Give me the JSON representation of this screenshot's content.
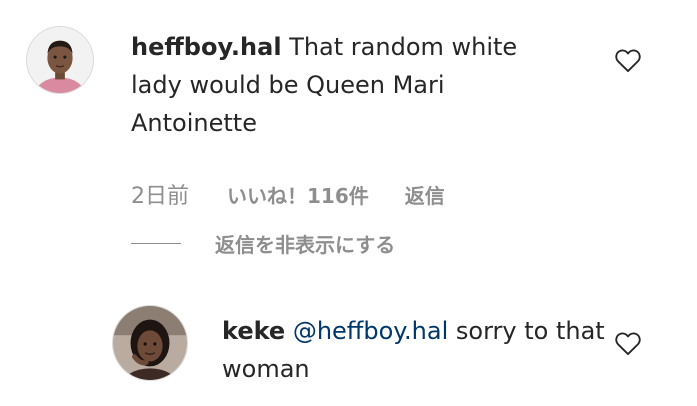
{
  "comment": {
    "username": "heffboy.hal",
    "text": "That random white lady would be Queen Mari Antoinette",
    "time": "2日前",
    "likes": "いいね！116件",
    "reply_label": "返信",
    "hide_replies_label": "返信を非表示にする",
    "avatar_icon": "user-avatar-icon",
    "like_icon": "heart-outline-icon"
  },
  "reply": {
    "username": "keke",
    "mention": "@heffboy.hal",
    "text": "sorry to that woman",
    "avatar_icon": "user-avatar-icon",
    "like_icon": "heart-outline-icon"
  },
  "colors": {
    "text": "#262626",
    "secondary": "#8e8e8e",
    "mention": "#00376b"
  }
}
